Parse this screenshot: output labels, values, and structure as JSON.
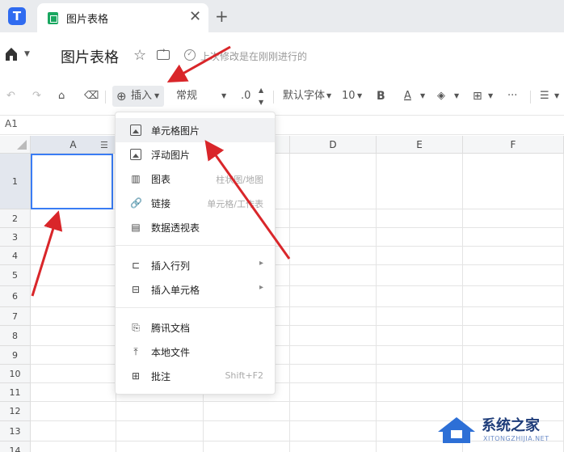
{
  "tab": {
    "title": "图片表格",
    "close": "✕",
    "add": "+"
  },
  "header": {
    "doc_title": "图片表格",
    "saved_status": "上次修改是在刚刚进行的"
  },
  "toolbar": {
    "insert_label": "插入",
    "format_value": "常规",
    "decimal_value": ".0",
    "font_family": "默认字体",
    "font_size": "10",
    "bold": "B",
    "font_color": "A",
    "more": "···"
  },
  "name_box": "A1",
  "columns": [
    "A",
    "B",
    "C",
    "D",
    "E",
    "F"
  ],
  "rows": [
    "1",
    "2",
    "3",
    "4",
    "5",
    "6",
    "7",
    "8",
    "9",
    "10",
    "11",
    "12",
    "13",
    "14"
  ],
  "insert_menu": {
    "items": [
      {
        "label": "单元格图片",
        "hint": ""
      },
      {
        "label": "浮动图片",
        "hint": ""
      },
      {
        "label": "图表",
        "hint": "柱状图/地图"
      },
      {
        "label": "链接",
        "hint": "单元格/工作表"
      },
      {
        "label": "数据透视表",
        "hint": ""
      },
      {
        "label": "插入行列",
        "hint": "▸"
      },
      {
        "label": "插入单元格",
        "hint": "▸"
      },
      {
        "label": "腾讯文档",
        "hint": ""
      },
      {
        "label": "本地文件",
        "hint": ""
      },
      {
        "label": "批注",
        "hint": "Shift+F2"
      }
    ]
  },
  "watermark": {
    "title": "系统之家",
    "url": "XITONGZHIJIA.NET"
  },
  "colors": {
    "accent": "#3a7cf4",
    "arrow": "#d9262a",
    "sheet_icon": "#1aa760",
    "app_logo": "#2f6bf0"
  }
}
